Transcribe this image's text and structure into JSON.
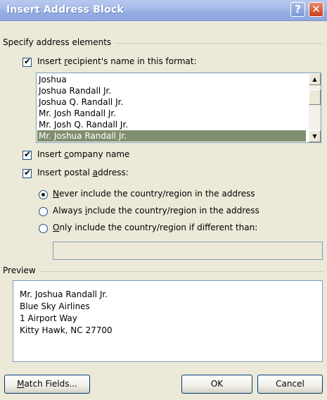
{
  "window": {
    "title": "Insert Address Block"
  },
  "specify": {
    "group_label": "Specify address elements",
    "recipient_checkbox": {
      "checked": true,
      "label_pre": "Insert ",
      "label_u": "r",
      "label_post": "ecipient's name in this format:"
    },
    "name_formats": [
      "Joshua",
      "Joshua Randall Jr.",
      "Joshua Q. Randall Jr.",
      "Mr. Josh Randall Jr.",
      "Mr. Josh Q. Randall Jr.",
      "Mr. Joshua Randall Jr."
    ],
    "selected_format": "Mr. Joshua Randall Jr.",
    "company_checkbox": {
      "checked": true,
      "label_pre": "Insert ",
      "label_u": "c",
      "label_post": "ompany name"
    },
    "postal_checkbox": {
      "checked": true,
      "label_pre": "Insert postal ",
      "label_u": "a",
      "label_post": "ddress:"
    },
    "country_options": [
      {
        "u": "N",
        "rest": "ever include the country/region in the address",
        "selected": true
      },
      {
        "pre": "Always ",
        "u": "i",
        "rest": "nclude the country/region in the address",
        "selected": false
      },
      {
        "u": "O",
        "rest": "nly include the country/region if different than:",
        "selected": false
      }
    ],
    "country_value": ""
  },
  "preview": {
    "group_label": "Preview",
    "lines": [
      "Mr. Joshua Randall Jr.",
      "Blue Sky Airlines",
      "1 Airport Way",
      "Kitty Hawk, NC 27700"
    ]
  },
  "buttons": {
    "match_fields": {
      "u": "M",
      "rest": "atch Fields..."
    },
    "ok": "OK",
    "cancel": "Cancel"
  },
  "icons": {
    "help": "?",
    "close": "✕",
    "check": "✔",
    "scroll_up": "▲",
    "scroll_down": "▼"
  }
}
